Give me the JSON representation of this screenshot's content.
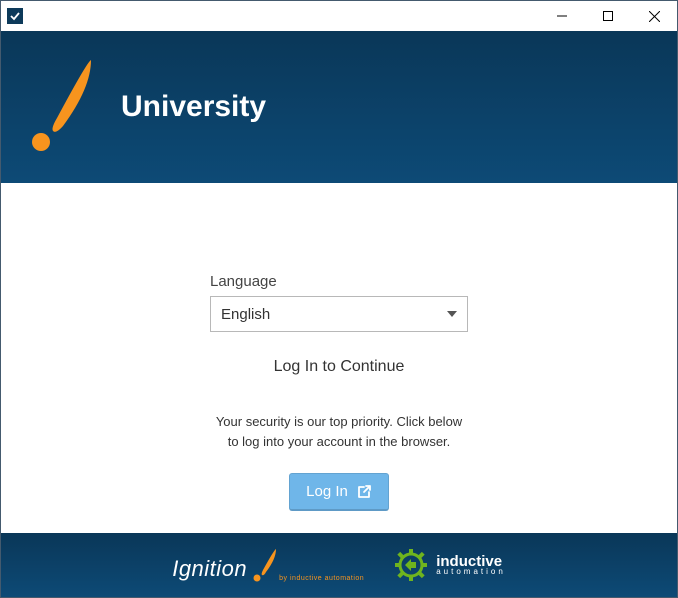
{
  "header": {
    "title": "University"
  },
  "form": {
    "language_label": "Language",
    "language_value": "English"
  },
  "login": {
    "subtitle": "Log In to Continue",
    "security_line1": "Your security is our top priority. Click below",
    "security_line2": "to log into your account in the browser.",
    "button_label": "Log In"
  },
  "footer": {
    "brand1": "Ignition",
    "brand1_sub": "by inductive automation",
    "brand2_line1": "inductive",
    "brand2_line2": "automation"
  }
}
